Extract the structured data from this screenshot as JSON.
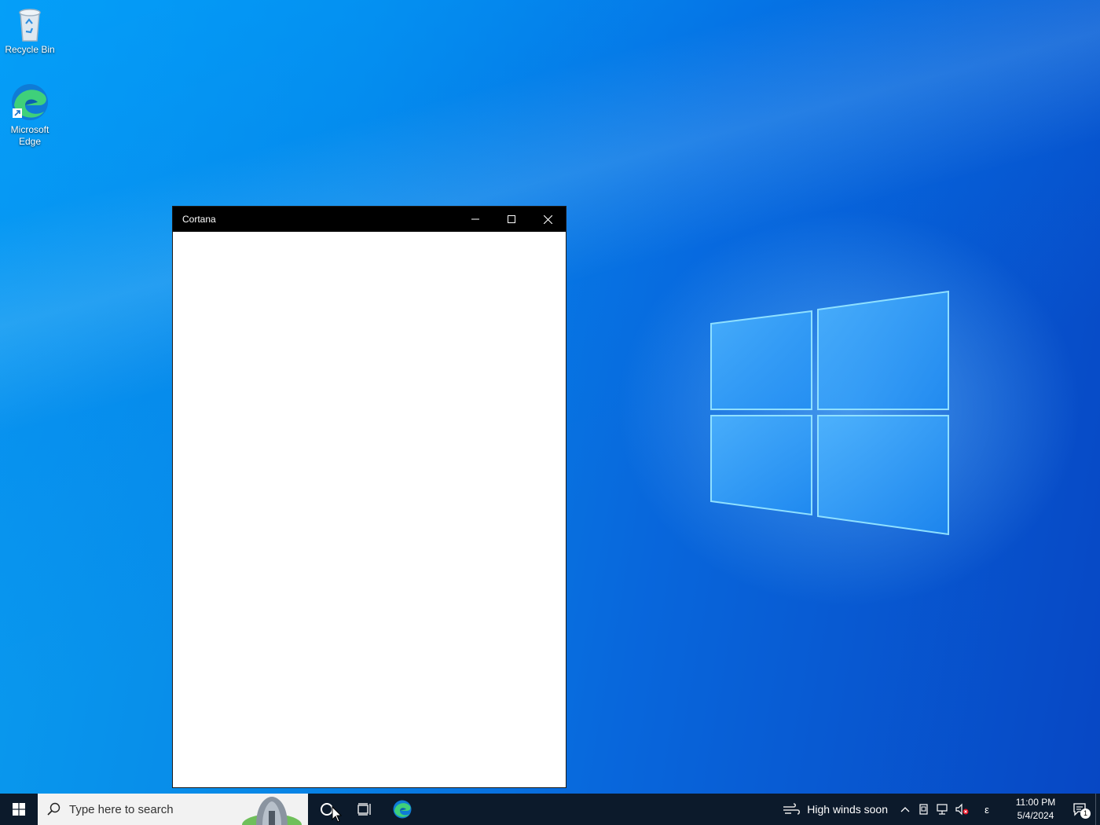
{
  "desktop": {
    "icons": [
      {
        "label": "Recycle Bin",
        "icon": "recycle-bin-icon"
      },
      {
        "label": "Microsoft Edge",
        "icon": "edge-icon"
      }
    ]
  },
  "window": {
    "title": "Cortana",
    "controls": {
      "minimize": "minimize-icon",
      "maximize": "maximize-icon",
      "close": "close-icon"
    }
  },
  "taskbar": {
    "search_placeholder": "Type here to search",
    "weather_text": "High winds soon",
    "ime_indicator": "ε",
    "clock_time": "11:00 PM",
    "clock_date": "5/4/2024",
    "notification_count": "1",
    "colors": {
      "background": "#0c1a2b",
      "search_bg": "#f2f2f2"
    }
  }
}
